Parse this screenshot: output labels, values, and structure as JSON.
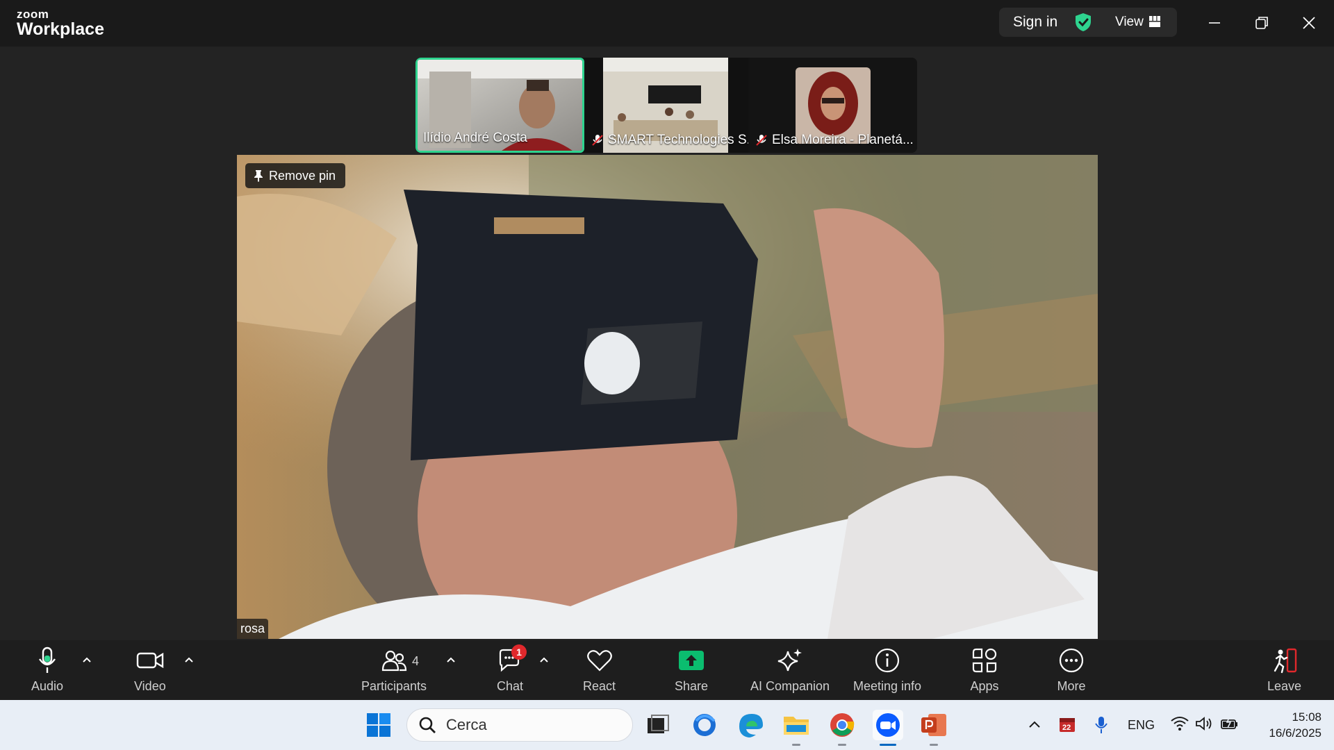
{
  "app": {
    "brand_small": "zoom",
    "brand_big": "Workplace"
  },
  "titlebar": {
    "sign_in": "Sign in",
    "view": "View"
  },
  "participants_strip": [
    {
      "name": "Ilídio André Costa",
      "muted": false,
      "active": true
    },
    {
      "name": "SMART Technologies S...",
      "muted": true,
      "active": false
    },
    {
      "name": "Elsa Moreira - Planetá...",
      "muted": true,
      "active": false
    }
  ],
  "main_video": {
    "pin_label": "Remove pin",
    "participant_name": "rosa"
  },
  "toolbar": {
    "audio": "Audio",
    "video": "Video",
    "participants": "Participants",
    "participants_count": "4",
    "chat": "Chat",
    "chat_badge": "1",
    "react": "React",
    "share": "Share",
    "ai_companion": "AI Companion",
    "meeting_info": "Meeting info",
    "apps": "Apps",
    "more": "More",
    "leave": "Leave"
  },
  "taskbar": {
    "search_placeholder": "Cerca",
    "calendar_badge": "22",
    "language": "ENG",
    "time": "15:08",
    "date": "16/6/2025"
  },
  "colors": {
    "active_speaker": "#2ed48f",
    "share_green": "#0bbd6f",
    "badge_red": "#e0282c",
    "leave_red": "#e0282c"
  }
}
